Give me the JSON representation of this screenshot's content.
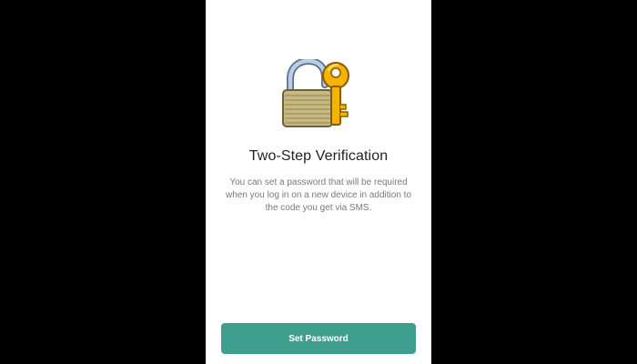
{
  "screen": {
    "title": "Two-Step Verification",
    "description": "You can set a password that will be required when you log in on a new device in addition to the code you get via SMS.",
    "illustration_icon": "lock-with-key-icon"
  },
  "actions": {
    "set_password_label": "Set Password"
  },
  "colors": {
    "accent": "#3f9f8e",
    "background": "#ffffff",
    "letterbox": "#000000",
    "title_text": "#222222",
    "body_text": "#7a7a7a"
  }
}
